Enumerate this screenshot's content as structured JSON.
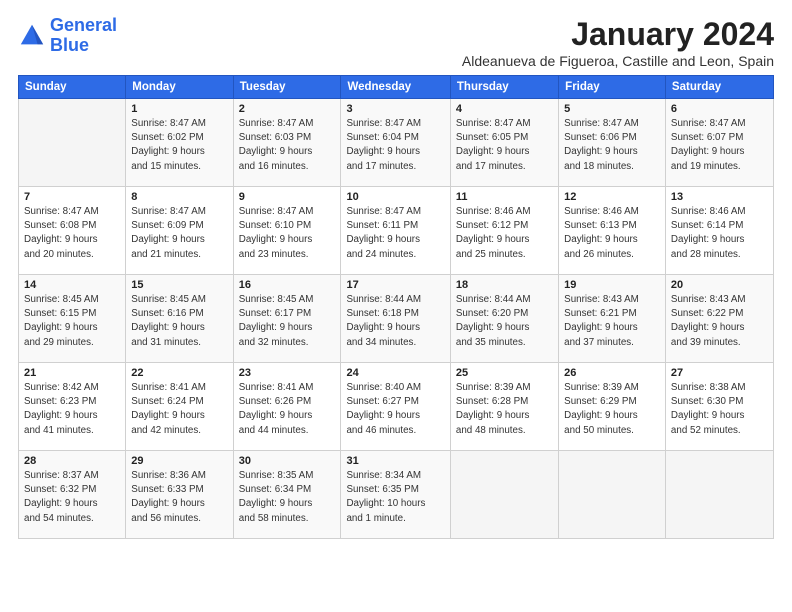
{
  "logo": {
    "line1": "General",
    "line2": "Blue"
  },
  "title": "January 2024",
  "subtitle": "Aldeanueva de Figueroa, Castille and Leon, Spain",
  "weekdays": [
    "Sunday",
    "Monday",
    "Tuesday",
    "Wednesday",
    "Thursday",
    "Friday",
    "Saturday"
  ],
  "weeks": [
    [
      {
        "day": "",
        "detail": ""
      },
      {
        "day": "1",
        "detail": "Sunrise: 8:47 AM\nSunset: 6:02 PM\nDaylight: 9 hours\nand 15 minutes."
      },
      {
        "day": "2",
        "detail": "Sunrise: 8:47 AM\nSunset: 6:03 PM\nDaylight: 9 hours\nand 16 minutes."
      },
      {
        "day": "3",
        "detail": "Sunrise: 8:47 AM\nSunset: 6:04 PM\nDaylight: 9 hours\nand 17 minutes."
      },
      {
        "day": "4",
        "detail": "Sunrise: 8:47 AM\nSunset: 6:05 PM\nDaylight: 9 hours\nand 17 minutes."
      },
      {
        "day": "5",
        "detail": "Sunrise: 8:47 AM\nSunset: 6:06 PM\nDaylight: 9 hours\nand 18 minutes."
      },
      {
        "day": "6",
        "detail": "Sunrise: 8:47 AM\nSunset: 6:07 PM\nDaylight: 9 hours\nand 19 minutes."
      }
    ],
    [
      {
        "day": "7",
        "detail": "Sunrise: 8:47 AM\nSunset: 6:08 PM\nDaylight: 9 hours\nand 20 minutes."
      },
      {
        "day": "8",
        "detail": "Sunrise: 8:47 AM\nSunset: 6:09 PM\nDaylight: 9 hours\nand 21 minutes."
      },
      {
        "day": "9",
        "detail": "Sunrise: 8:47 AM\nSunset: 6:10 PM\nDaylight: 9 hours\nand 23 minutes."
      },
      {
        "day": "10",
        "detail": "Sunrise: 8:47 AM\nSunset: 6:11 PM\nDaylight: 9 hours\nand 24 minutes."
      },
      {
        "day": "11",
        "detail": "Sunrise: 8:46 AM\nSunset: 6:12 PM\nDaylight: 9 hours\nand 25 minutes."
      },
      {
        "day": "12",
        "detail": "Sunrise: 8:46 AM\nSunset: 6:13 PM\nDaylight: 9 hours\nand 26 minutes."
      },
      {
        "day": "13",
        "detail": "Sunrise: 8:46 AM\nSunset: 6:14 PM\nDaylight: 9 hours\nand 28 minutes."
      }
    ],
    [
      {
        "day": "14",
        "detail": "Sunrise: 8:45 AM\nSunset: 6:15 PM\nDaylight: 9 hours\nand 29 minutes."
      },
      {
        "day": "15",
        "detail": "Sunrise: 8:45 AM\nSunset: 6:16 PM\nDaylight: 9 hours\nand 31 minutes."
      },
      {
        "day": "16",
        "detail": "Sunrise: 8:45 AM\nSunset: 6:17 PM\nDaylight: 9 hours\nand 32 minutes."
      },
      {
        "day": "17",
        "detail": "Sunrise: 8:44 AM\nSunset: 6:18 PM\nDaylight: 9 hours\nand 34 minutes."
      },
      {
        "day": "18",
        "detail": "Sunrise: 8:44 AM\nSunset: 6:20 PM\nDaylight: 9 hours\nand 35 minutes."
      },
      {
        "day": "19",
        "detail": "Sunrise: 8:43 AM\nSunset: 6:21 PM\nDaylight: 9 hours\nand 37 minutes."
      },
      {
        "day": "20",
        "detail": "Sunrise: 8:43 AM\nSunset: 6:22 PM\nDaylight: 9 hours\nand 39 minutes."
      }
    ],
    [
      {
        "day": "21",
        "detail": "Sunrise: 8:42 AM\nSunset: 6:23 PM\nDaylight: 9 hours\nand 41 minutes."
      },
      {
        "day": "22",
        "detail": "Sunrise: 8:41 AM\nSunset: 6:24 PM\nDaylight: 9 hours\nand 42 minutes."
      },
      {
        "day": "23",
        "detail": "Sunrise: 8:41 AM\nSunset: 6:26 PM\nDaylight: 9 hours\nand 44 minutes."
      },
      {
        "day": "24",
        "detail": "Sunrise: 8:40 AM\nSunset: 6:27 PM\nDaylight: 9 hours\nand 46 minutes."
      },
      {
        "day": "25",
        "detail": "Sunrise: 8:39 AM\nSunset: 6:28 PM\nDaylight: 9 hours\nand 48 minutes."
      },
      {
        "day": "26",
        "detail": "Sunrise: 8:39 AM\nSunset: 6:29 PM\nDaylight: 9 hours\nand 50 minutes."
      },
      {
        "day": "27",
        "detail": "Sunrise: 8:38 AM\nSunset: 6:30 PM\nDaylight: 9 hours\nand 52 minutes."
      }
    ],
    [
      {
        "day": "28",
        "detail": "Sunrise: 8:37 AM\nSunset: 6:32 PM\nDaylight: 9 hours\nand 54 minutes."
      },
      {
        "day": "29",
        "detail": "Sunrise: 8:36 AM\nSunset: 6:33 PM\nDaylight: 9 hours\nand 56 minutes."
      },
      {
        "day": "30",
        "detail": "Sunrise: 8:35 AM\nSunset: 6:34 PM\nDaylight: 9 hours\nand 58 minutes."
      },
      {
        "day": "31",
        "detail": "Sunrise: 8:34 AM\nSunset: 6:35 PM\nDaylight: 10 hours\nand 1 minute."
      },
      {
        "day": "",
        "detail": ""
      },
      {
        "day": "",
        "detail": ""
      },
      {
        "day": "",
        "detail": ""
      }
    ]
  ]
}
